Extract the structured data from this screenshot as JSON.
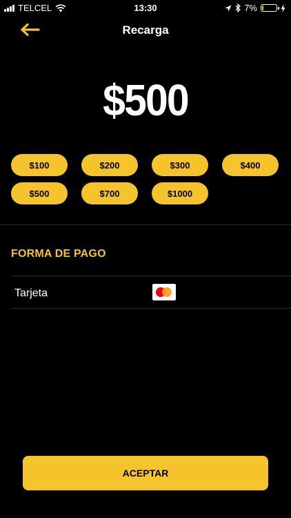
{
  "status_bar": {
    "carrier": "TELCEL",
    "time": "13:30",
    "battery_percent": "7%",
    "battery_level": 0.07,
    "icons": [
      "signal-icon",
      "wifi-icon",
      "location-icon",
      "bluetooth-icon",
      "battery-icon",
      "charging-icon"
    ]
  },
  "header": {
    "title": "Recarga",
    "back_icon": "arrow-left-icon"
  },
  "amount": {
    "selected": "$500"
  },
  "chips": [
    {
      "label": "$100"
    },
    {
      "label": "$200"
    },
    {
      "label": "$300"
    },
    {
      "label": "$400"
    },
    {
      "label": "$500"
    },
    {
      "label": "$700"
    },
    {
      "label": "$1000"
    }
  ],
  "payment": {
    "section_title": "FORMA DE PAGO",
    "method_label": "Tarjeta",
    "card_icon": "mastercard-icon"
  },
  "actions": {
    "accept_label": "ACEPTAR"
  },
  "colors": {
    "accent": "#f5c32c",
    "background": "#000000"
  }
}
